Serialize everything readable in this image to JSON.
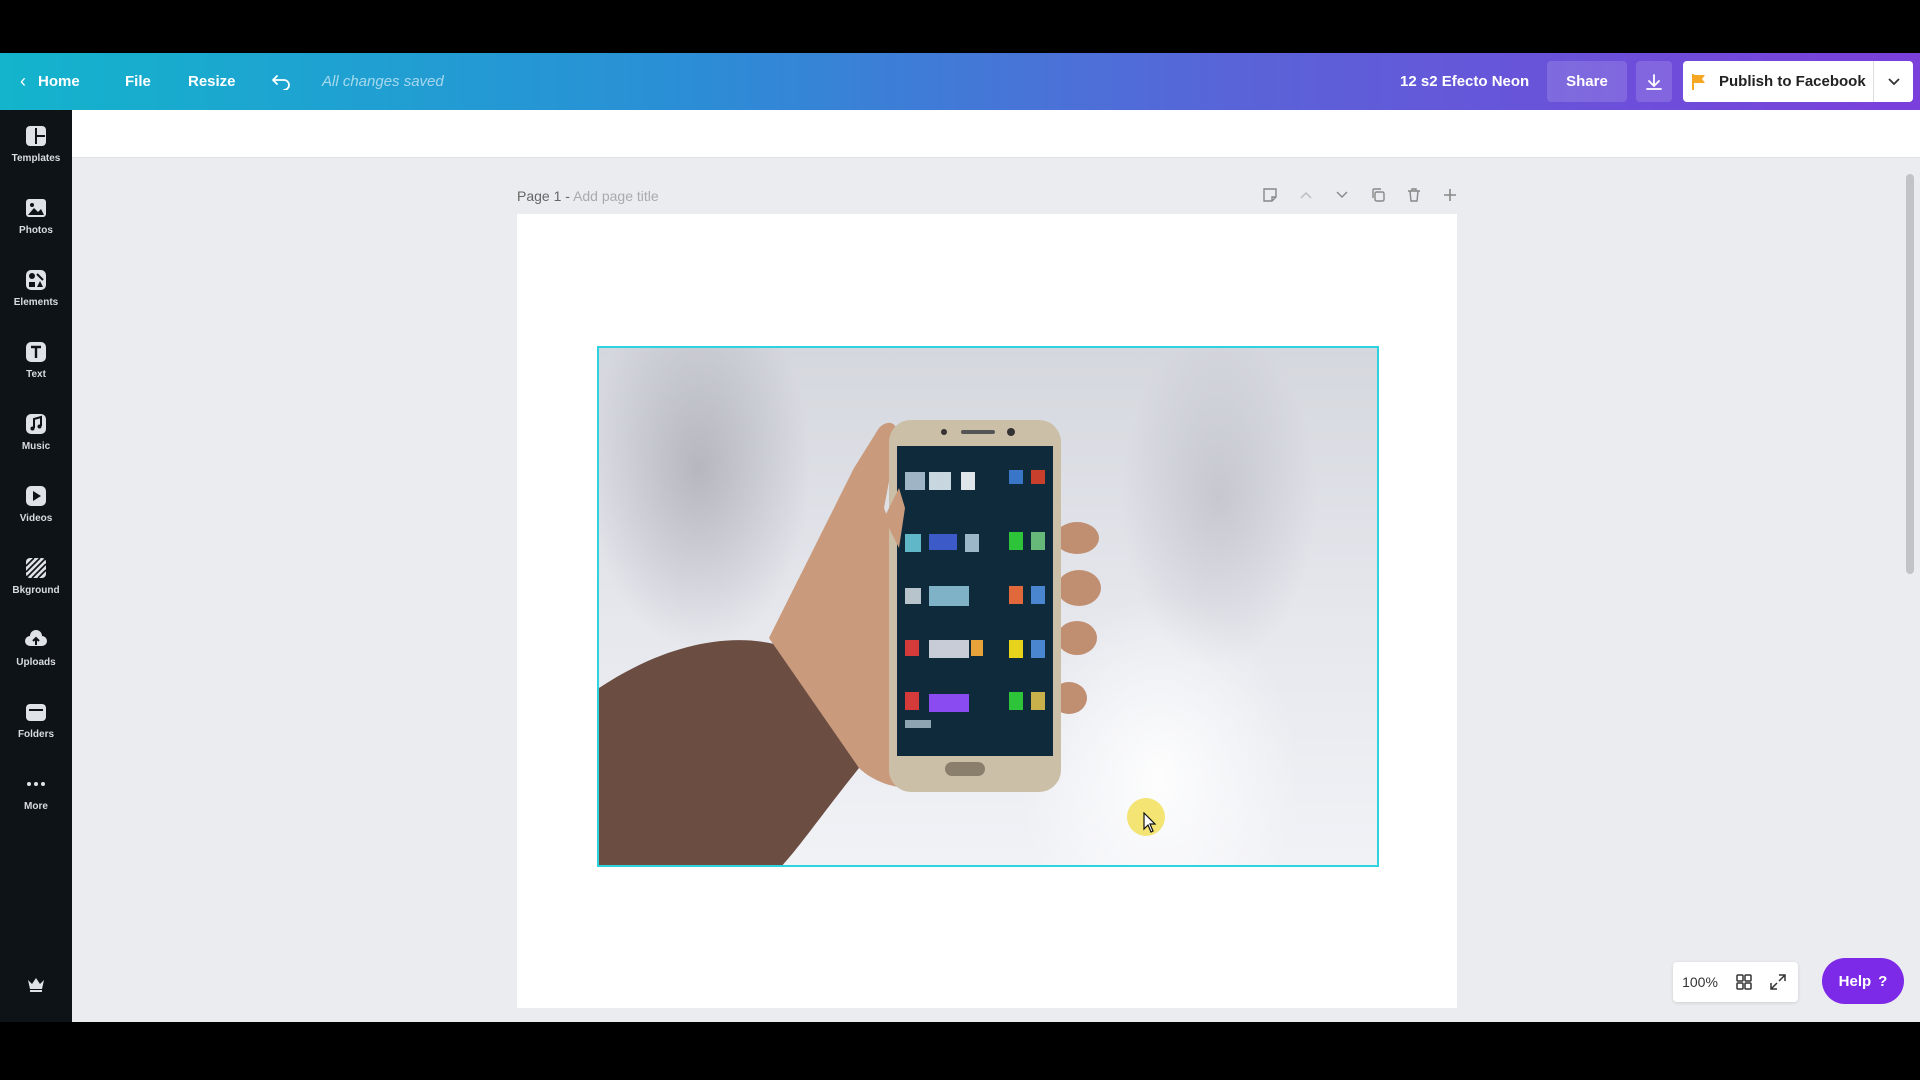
{
  "header": {
    "home_label": "Home",
    "file_label": "File",
    "resize_label": "Resize",
    "save_status": "All changes saved",
    "document_name": "12 s2 Efecto Neon",
    "share_label": "Share",
    "publish_label": "Publish to Facebook"
  },
  "sidebar": {
    "items": [
      {
        "label": "Templates",
        "icon": "templates-icon"
      },
      {
        "label": "Photos",
        "icon": "photos-icon"
      },
      {
        "label": "Elements",
        "icon": "elements-icon"
      },
      {
        "label": "Text",
        "icon": "text-icon"
      },
      {
        "label": "Music",
        "icon": "music-icon"
      },
      {
        "label": "Videos",
        "icon": "videos-icon"
      },
      {
        "label": "Bkground",
        "icon": "background-icon"
      },
      {
        "label": "Uploads",
        "icon": "uploads-icon"
      },
      {
        "label": "Folders",
        "icon": "folders-icon"
      },
      {
        "label": "More",
        "icon": "more-icon"
      }
    ]
  },
  "page": {
    "number_label": "Page 1 -",
    "title_placeholder": "Add page title"
  },
  "zoom": {
    "value": "100%"
  },
  "help": {
    "label": "Help",
    "glyph": "?"
  },
  "colors": {
    "accent_selection": "#2ed3e0",
    "help_purple": "#7d2ae8",
    "sidebar_bg": "#0e1318",
    "header_gradient_start": "#13b4cc",
    "header_gradient_end": "#7b3fdb"
  }
}
